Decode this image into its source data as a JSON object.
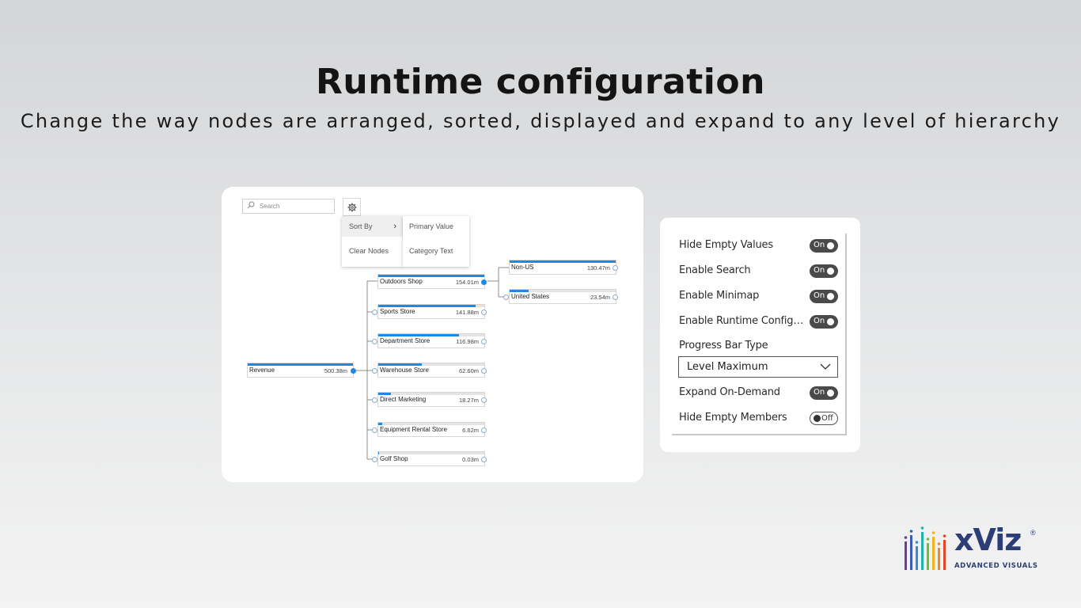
{
  "header": {
    "title": "Runtime configuration",
    "subtitle": "Change the way nodes are arranged, sorted, displayed and expand to any level of hierarchy"
  },
  "tree_panel": {
    "search": {
      "placeholder": "Search"
    },
    "settings_icon": "gear-icon",
    "menu": {
      "items": [
        {
          "label": "Sort By",
          "has_submenu": true
        },
        {
          "label": "Clear Nodes"
        }
      ],
      "submenu": [
        {
          "label": "Primary Value"
        },
        {
          "label": "Category Text"
        }
      ]
    },
    "accent": "#1e88e5",
    "root": {
      "label": "Revenue",
      "value": "500.38m",
      "progress": 1.0
    },
    "level1": [
      {
        "label": "Outdoors Shop",
        "value": "154.01m",
        "progress": 1.0,
        "expanded": true
      },
      {
        "label": "Sports Store",
        "value": "141.88m",
        "progress": 0.92
      },
      {
        "label": "Department Store",
        "value": "116.98m",
        "progress": 0.76
      },
      {
        "label": "Warehouse Store",
        "value": "62.60m",
        "progress": 0.41
      },
      {
        "label": "Direct Marketing",
        "value": "18.27m",
        "progress": 0.12
      },
      {
        "label": "Equipment Rental Store",
        "value": "6.62m",
        "progress": 0.04
      },
      {
        "label": "Golf Shop",
        "value": "0.03m",
        "progress": 0.01
      }
    ],
    "level2": [
      {
        "label": "Non-US",
        "value": "130.47m",
        "progress": 1.0
      },
      {
        "label": "United States",
        "value": "23.54m",
        "progress": 0.18
      }
    ]
  },
  "settings_panel": {
    "toggles": [
      {
        "label": "Hide Empty Values",
        "state": "On"
      },
      {
        "label": "Enable Search",
        "state": "On"
      },
      {
        "label": "Enable Minimap",
        "state": "On"
      },
      {
        "label": "Enable Runtime Configur...",
        "state": "On"
      }
    ],
    "progress_bar_type": {
      "label": "Progress Bar Type",
      "selected": "Level Maximum"
    },
    "toggles_after": [
      {
        "label": "Expand On-Demand",
        "state": "On"
      },
      {
        "label": "Hide Empty Members",
        "state": "Off"
      }
    ]
  },
  "logo": {
    "word": "xViz",
    "tagline": "ADVANCED  VISUALS",
    "registered": "®",
    "bar_colors": [
      "#6a3fa0",
      "#3b5bb5",
      "#2a8fd6",
      "#22b3a8",
      "#6cbf3a",
      "#f2b323",
      "#f08a24",
      "#e0462a"
    ]
  }
}
